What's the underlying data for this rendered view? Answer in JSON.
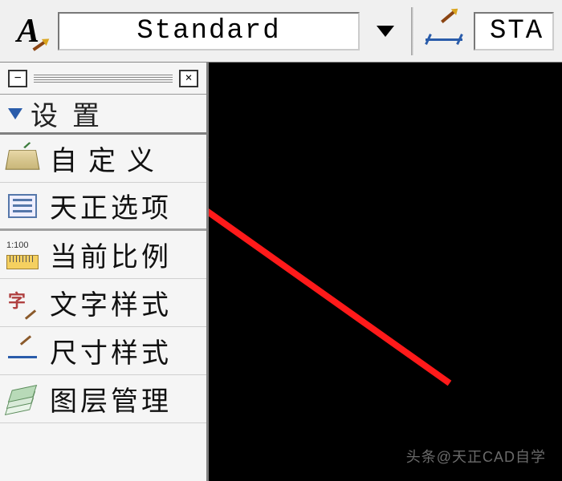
{
  "toolbar": {
    "text_style_dropdown": "Standard",
    "dim_style_dropdown": "STA"
  },
  "panel": {
    "title": "设置",
    "items": [
      {
        "label": "自定义",
        "icon": "book-pencil-icon",
        "spaced": true
      },
      {
        "label": "天正选项",
        "icon": "options-dialog-icon",
        "spaced": false
      },
      {
        "label": "当前比例",
        "icon": "scale-ruler-icon",
        "spaced": false,
        "scale_text": "1:100"
      },
      {
        "label": "文字样式",
        "icon": "text-style-icon",
        "spaced": false
      },
      {
        "label": "尺寸样式",
        "icon": "dimension-style-icon",
        "spaced": false
      },
      {
        "label": "图层管理",
        "icon": "layer-manager-icon",
        "spaced": false
      }
    ]
  },
  "watermark": {
    "prefix": "头条",
    "handle": "@天正CAD自学"
  }
}
